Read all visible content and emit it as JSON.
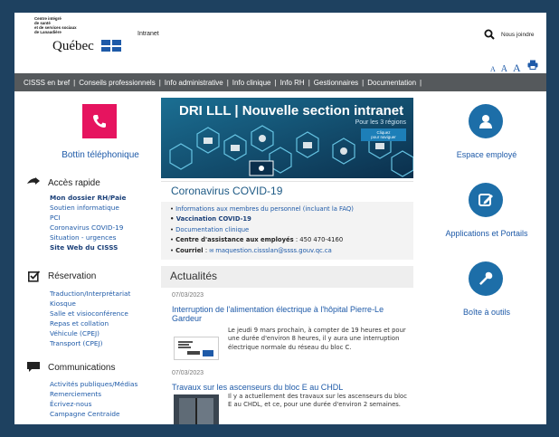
{
  "header": {
    "logo_small_text": "Centre intégré\nde santé\net de services sociaux\nde Lanaudière",
    "logo_main": "Québec",
    "site_label": "Intranet",
    "search_label": "Nous joindre",
    "font_sizes": [
      "A",
      "A",
      "A"
    ]
  },
  "nav": {
    "items": [
      "CISSS en bref",
      "Conseils professionnels",
      "Info administrative",
      "Info clinique",
      "Info RH",
      "Gestionnaires",
      "Documentation"
    ],
    "separator": "|"
  },
  "left": {
    "phone_label": "Bottin téléphonique",
    "acces_rapide": {
      "title": "Accès rapide",
      "links": [
        {
          "label": "Mon dossier RH/Paie",
          "bold": true
        },
        {
          "label": "Soutien informatique",
          "bold": false
        },
        {
          "label": "PCI",
          "bold": false
        },
        {
          "label": "Coronavirus COVID-19",
          "bold": false
        },
        {
          "label": "Situation - urgences",
          "bold": false
        },
        {
          "label": "Site Web du CISSS",
          "bold": true
        }
      ]
    },
    "reservation": {
      "title": "Réservation",
      "links": [
        "Traduction/Interprétariat",
        "Kiosque",
        "Salle et visioconférence",
        "Repas et collation",
        "Véhicule (CPEJ)",
        "Transport (CPEJ)"
      ]
    },
    "communications": {
      "title": "Communications",
      "links": [
        "Activités publiques/Médias",
        "Remerciements",
        "Écrivez-nous",
        "Campagne Centraide"
      ]
    }
  },
  "banner": {
    "title": "DRI LLL | Nouvelle section intranet",
    "subtitle": "Pour les 3 régions",
    "button": "Cliquez\npour naviguer"
  },
  "covid": {
    "title": "Coronavirus COVID-19",
    "items": [
      {
        "label": "Informations aux membres du personnel (incluant la FAQ)",
        "style": "link"
      },
      {
        "label": "Vaccination COVID-19",
        "style": "bold"
      },
      {
        "label": "Documentation clinique",
        "style": "link"
      },
      {
        "strong": "Centre d'assistance aux employés",
        "rest": " : 450 470-4160",
        "style": "mixed"
      },
      {
        "strong": "Courriel",
        "rest": " : ",
        "link": "maquestion.cissslan@ssss.gouv.qc.ca",
        "style": "mail"
      }
    ]
  },
  "actualites": {
    "title": "Actualités",
    "news": [
      {
        "date": "07/03/2023",
        "title": "Interruption de l'alimentation électrique à l'hôpital Pierre-Le Gardeur",
        "text": "Le jeudi 9 mars prochain, à compter de 19 heures et pour une durée d'environ 8 heures, il y aura une interruption électrique normale du réseau du bloc C."
      },
      {
        "date": "07/03/2023",
        "title": "Travaux sur les ascenseurs du bloc E au CHDL",
        "text": "Il y a actuellement des travaux sur les ascenseurs du bloc E au CHDL, et ce, pour une durée d'environ 2 semaines."
      }
    ]
  },
  "right": {
    "items": [
      {
        "label": "Espace employé",
        "icon": "user-icon"
      },
      {
        "label": "Applications et Portails",
        "icon": "edit-icon"
      },
      {
        "label": "Boîte à outils",
        "icon": "wrench-icon"
      }
    ]
  },
  "colors": {
    "frame": "#1e4160",
    "navbar": "#55595c",
    "accent_pink": "#e6145f",
    "accent_blue": "#1d6ea8",
    "link": "#1e5aa8"
  }
}
